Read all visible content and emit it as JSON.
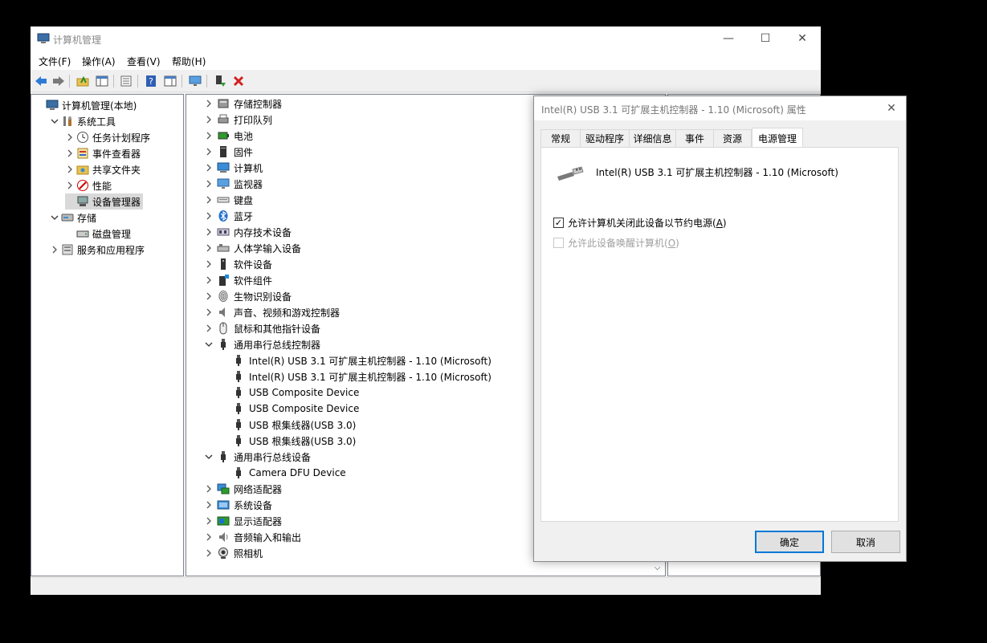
{
  "window": {
    "title": "计算机管理",
    "minimize_glyph": "—",
    "maximize_glyph": "☐",
    "close_glyph": "✕"
  },
  "menu": [
    "文件(F)",
    "操作(A)",
    "查看(V)",
    "帮助(H)"
  ],
  "toolbar_icons": [
    "back-arrow-icon",
    "forward-arrow-icon",
    "up-folder-icon",
    "show-hide-tree-icon",
    "properties-icon",
    "help-icon",
    "show-action-pane-icon",
    "monitor-icon",
    "update-driver-icon",
    "uninstall-x-icon"
  ],
  "left_tree": [
    {
      "label": "计算机管理(本地)",
      "icon": "computer-management-icon",
      "level": 0,
      "expander": ""
    },
    {
      "label": "系统工具",
      "icon": "tools-icon",
      "level": 1,
      "expander": "expanded"
    },
    {
      "label": "任务计划程序",
      "icon": "clock-icon",
      "level": 2,
      "expander": "collapsed"
    },
    {
      "label": "事件查看器",
      "icon": "event-viewer-icon",
      "level": 2,
      "expander": "collapsed"
    },
    {
      "label": "共享文件夹",
      "icon": "shared-folder-icon",
      "level": 2,
      "expander": "collapsed"
    },
    {
      "label": "性能",
      "icon": "performance-icon",
      "level": 2,
      "expander": "collapsed"
    },
    {
      "label": "设备管理器",
      "icon": "device-manager-icon",
      "level": 2,
      "expander": "",
      "selected": true
    },
    {
      "label": "存储",
      "icon": "storage-icon",
      "level": 1,
      "expander": "expanded"
    },
    {
      "label": "磁盘管理",
      "icon": "disk-icon",
      "level": 2,
      "expander": ""
    },
    {
      "label": "服务和应用程序",
      "icon": "services-icon",
      "level": 1,
      "expander": "collapsed"
    }
  ],
  "devices": [
    {
      "label": "存储控制器",
      "icon": "storage-controller-icon",
      "level": 0,
      "expander": "collapsed"
    },
    {
      "label": "打印队列",
      "icon": "printer-icon",
      "level": 0,
      "expander": "collapsed"
    },
    {
      "label": "电池",
      "icon": "battery-icon",
      "level": 0,
      "expander": "collapsed"
    },
    {
      "label": "固件",
      "icon": "firmware-icon",
      "level": 0,
      "expander": "collapsed"
    },
    {
      "label": "计算机",
      "icon": "computer-icon",
      "level": 0,
      "expander": "collapsed"
    },
    {
      "label": "监视器",
      "icon": "monitor-icon",
      "level": 0,
      "expander": "collapsed"
    },
    {
      "label": "键盘",
      "icon": "keyboard-icon",
      "level": 0,
      "expander": "collapsed"
    },
    {
      "label": "蓝牙",
      "icon": "bluetooth-icon",
      "level": 0,
      "expander": "collapsed"
    },
    {
      "label": "内存技术设备",
      "icon": "memory-icon",
      "level": 0,
      "expander": "collapsed"
    },
    {
      "label": "人体学输入设备",
      "icon": "hid-icon",
      "level": 0,
      "expander": "collapsed"
    },
    {
      "label": "软件设备",
      "icon": "software-device-icon",
      "level": 0,
      "expander": "collapsed"
    },
    {
      "label": "软件组件",
      "icon": "software-component-icon",
      "level": 0,
      "expander": "collapsed"
    },
    {
      "label": "生物识别设备",
      "icon": "fingerprint-icon",
      "level": 0,
      "expander": "collapsed"
    },
    {
      "label": "声音、视频和游戏控制器",
      "icon": "speaker-icon",
      "level": 0,
      "expander": "collapsed"
    },
    {
      "label": "鼠标和其他指针设备",
      "icon": "mouse-icon",
      "level": 0,
      "expander": "collapsed"
    },
    {
      "label": "通用串行总线控制器",
      "icon": "usb-icon",
      "level": 0,
      "expander": "expanded"
    },
    {
      "label": "Intel(R) USB 3.1 可扩展主机控制器 - 1.10 (Microsoft)",
      "icon": "usb-icon",
      "level": 1,
      "expander": ""
    },
    {
      "label": "Intel(R) USB 3.1 可扩展主机控制器 - 1.10 (Microsoft)",
      "icon": "usb-icon",
      "level": 1,
      "expander": ""
    },
    {
      "label": "USB Composite Device",
      "icon": "usb-icon",
      "level": 1,
      "expander": ""
    },
    {
      "label": "USB Composite Device",
      "icon": "usb-icon",
      "level": 1,
      "expander": ""
    },
    {
      "label": "USB 根集线器(USB 3.0)",
      "icon": "usb-icon",
      "level": 1,
      "expander": ""
    },
    {
      "label": "USB 根集线器(USB 3.0)",
      "icon": "usb-icon",
      "level": 1,
      "expander": ""
    },
    {
      "label": "通用串行总线设备",
      "icon": "usb-icon",
      "level": 0,
      "expander": "expanded"
    },
    {
      "label": "Camera DFU Device",
      "icon": "usb-icon",
      "level": 1,
      "expander": ""
    },
    {
      "label": "网络适配器",
      "icon": "network-icon",
      "level": 0,
      "expander": "collapsed"
    },
    {
      "label": "系统设备",
      "icon": "system-device-icon",
      "level": 0,
      "expander": "collapsed"
    },
    {
      "label": "显示适配器",
      "icon": "display-adapter-icon",
      "level": 0,
      "expander": "collapsed"
    },
    {
      "label": "音频输入和输出",
      "icon": "audio-icon",
      "level": 0,
      "expander": "collapsed"
    },
    {
      "label": "照相机",
      "icon": "camera-icon",
      "level": 0,
      "expander": "collapsed"
    }
  ],
  "dialog": {
    "title": "Intel(R) USB 3.1 可扩展主机控制器 - 1.10 (Microsoft) 属性",
    "close_glyph": "✕",
    "tabs": [
      "常规",
      "驱动程序",
      "详细信息",
      "事件",
      "资源",
      "电源管理"
    ],
    "active_tab": "电源管理",
    "device_name": "Intel(R) USB 3.1 可扩展主机控制器 - 1.10 (Microsoft)",
    "option_power_off": {
      "prefix": "允许计算机关闭此设备以节约电源(",
      "key": "A",
      "suffix": ")",
      "checked": true,
      "enabled": true
    },
    "option_wake": {
      "prefix": "允许此设备唤醒计算机(",
      "key": "O",
      "suffix": ")",
      "checked": false,
      "enabled": false
    },
    "ok_label": "确定",
    "cancel_label": "取消"
  }
}
